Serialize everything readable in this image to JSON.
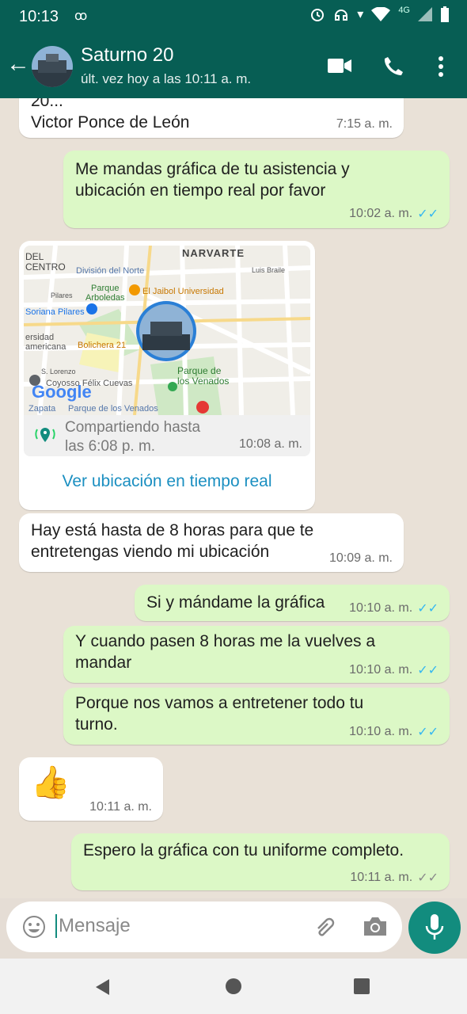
{
  "status": {
    "time": "10:13",
    "network": "4G"
  },
  "header": {
    "contact_name": "Saturno 20",
    "last_seen": "últ. vez hoy a las 10:11 a. m."
  },
  "messages": [
    {
      "dir": "in",
      "text": "20...\nVictor Ponce de León",
      "time": "7:15 a. m."
    },
    {
      "dir": "out",
      "text": "Me mandas gráfica de tu asistencia y\nubicación en tiempo real por favor",
      "time": "10:02 a. m.",
      "ticks": "read"
    },
    {
      "dir": "in",
      "type": "location",
      "sharing": "Compartiendo hasta\nlas 6:08 p. m.",
      "time": "10:08 a. m.",
      "action": "Ver ubicación en tiempo real"
    },
    {
      "dir": "in",
      "text": "Hay está hasta de 8 horas para que te\nentretengas viendo mi ubicación",
      "time": "10:09 a. m."
    },
    {
      "dir": "out",
      "text": "Si y mándame la gráfica",
      "time": "10:10 a. m.",
      "ticks": "read"
    },
    {
      "dir": "out",
      "text": "Y cuando pasen 8 horas me la vuelves a\nmandar",
      "time": "10:10 a. m.",
      "ticks": "read"
    },
    {
      "dir": "out",
      "text": "Porque nos vamos a entretener  todo tu\nturno.",
      "time": "10:10 a. m.",
      "ticks": "read"
    },
    {
      "dir": "in",
      "text": "👍",
      "time": "10:11 a. m."
    },
    {
      "dir": "out",
      "text": "Espero la gráfica con tu uniforme completo.",
      "time": "10:11 a. m.",
      "ticks": "delivered"
    }
  ],
  "map_labels": {
    "narvarte": "NARVARTE",
    "del_centro": "DEL\nCENTRO",
    "division": "División del Norte",
    "luis_braile": "Luis Braile",
    "parque_arboledas": "Parque\nArboledas",
    "jaibol": "El Jaibol Universidad",
    "pilares": "Pilares",
    "soriana": "Soriana Pilares",
    "ciudad_univ": "ersidad\namericana",
    "bolichera": "Bolichera 21",
    "lorenzo": "S. Lorenzo",
    "yosso": "Coyosso Félix Cuevas",
    "venados": "Parque de\nlos Venados",
    "zapata": "Zapata",
    "parque_venados_bottom": "Parque de los Venados",
    "google": "Google"
  },
  "composer": {
    "placeholder": "Mensaje"
  },
  "colors": {
    "header": "#075e54",
    "outgoing": "#dcf8c6",
    "incoming": "#ffffff",
    "accent": "#128c7e",
    "read_ticks": "#34b7f1"
  },
  "icons": [
    "back-arrow-icon",
    "video-call-icon",
    "phone-icon",
    "more-vert-icon",
    "emoji-icon",
    "attach-icon",
    "camera-icon",
    "mic-icon"
  ]
}
